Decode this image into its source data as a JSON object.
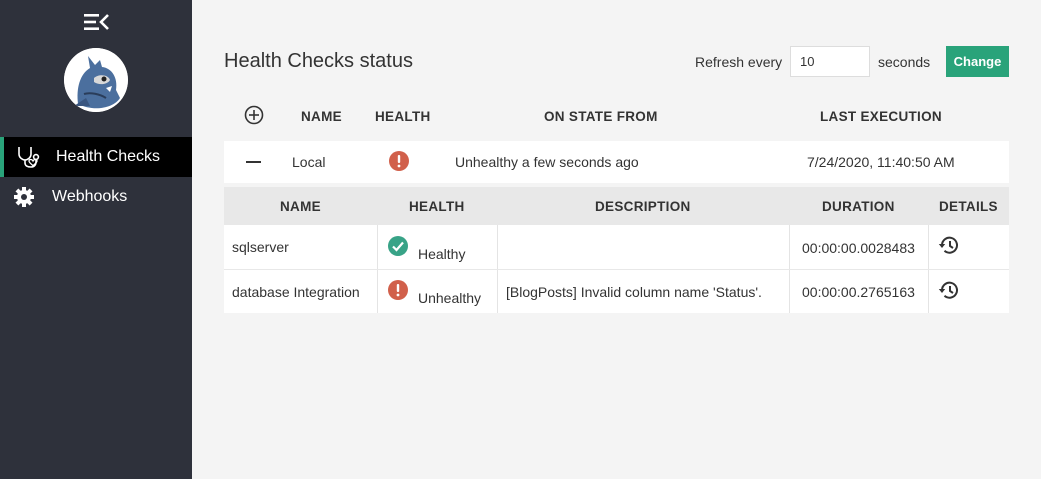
{
  "sidebar": {
    "items": [
      {
        "label": "Health Checks",
        "icon": "stethoscope-icon",
        "active": true
      },
      {
        "label": "Webhooks",
        "icon": "gear-icon",
        "active": false
      }
    ]
  },
  "main": {
    "title": "Health Checks status",
    "refresh": {
      "label": "Refresh every",
      "value": "10",
      "suffix": "seconds",
      "button": "Change"
    }
  },
  "table": {
    "headers": [
      "NAME",
      "HEALTH",
      "ON STATE FROM",
      "LAST EXECUTION"
    ],
    "rows": [
      {
        "name": "Local",
        "health": "unhealthy",
        "on_state_from": "Unhealthy a few seconds ago",
        "last_execution": "7/24/2020, 11:40:50 AM"
      }
    ]
  },
  "subtable": {
    "headers": [
      "NAME",
      "HEALTH",
      "DESCRIPTION",
      "DURATION",
      "DETAILS"
    ],
    "rows": [
      {
        "name": "sqlserver",
        "health": "Healthy",
        "description": "",
        "duration": "00:00:00.0028483"
      },
      {
        "name": "database Integration",
        "health": "Unhealthy",
        "description": "[BlogPosts] Invalid column name 'Status'.",
        "duration": "00:00:00.2765163"
      }
    ]
  },
  "colors": {
    "sidebar_bg": "#2e313b",
    "accent": "#29a37a",
    "healthy": "#38a387",
    "unhealthy": "#d1604b"
  }
}
